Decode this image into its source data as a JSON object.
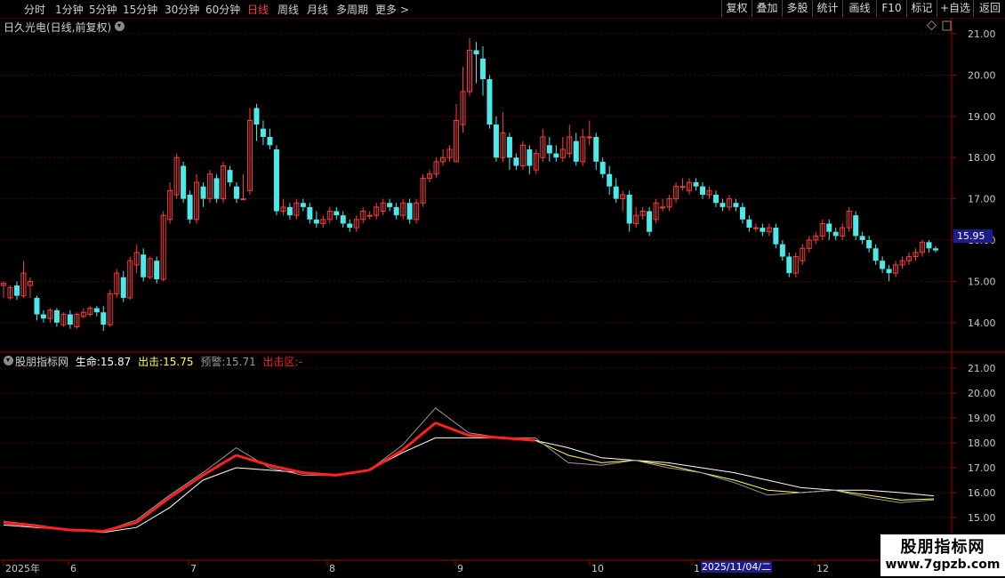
{
  "toolbar": {
    "periods": [
      "分时",
      "1分钟",
      "5分钟",
      "15分钟",
      "30分钟",
      "60分钟",
      "日线",
      "周线",
      "月线",
      "多周期",
      "更多 >"
    ],
    "active_period": "日线",
    "right_buttons": [
      "复权",
      "叠加",
      "多股",
      "统计",
      "画线",
      "F10",
      "标记",
      "+自选",
      "返回"
    ]
  },
  "chart_title": "日久光电(日线,前复权)",
  "current_price": "15.95",
  "indicator": {
    "name": "股朋指标网",
    "life_label": "生命:",
    "life_value": "15.87",
    "exit_label": "出击:",
    "exit_value": "15.75",
    "warn_label": "预警:",
    "warn_value": "15.71",
    "zone_label": "出击区:",
    "zone_value": "-"
  },
  "x_axis": {
    "labels": [
      "2025年",
      "6",
      "7",
      "8",
      "9",
      "10",
      "1",
      "12"
    ],
    "cursor_date": "2025/11/04/二"
  },
  "watermark": {
    "line1": "股朋指标网",
    "line2": "www.7gpzb.com"
  },
  "colors": {
    "up": "#ff3b3b",
    "down": "#4de8e8",
    "grid": "#5a0000",
    "axis": "#a00000",
    "life": "#ffffff",
    "exit": "#ffff55",
    "red_fill": "#ff2020"
  },
  "chart_data": [
    {
      "type": "candlestick",
      "title": "日久光电(日线,前复权)",
      "y_ticks": [
        21.0,
        20.0,
        19.0,
        18.0,
        17.0,
        16.0,
        15.0,
        14.0
      ],
      "ylim": [
        13.5,
        21.4
      ],
      "candles": [
        [
          14.9,
          14.95,
          14.6,
          15.0
        ],
        [
          14.6,
          14.85,
          14.55,
          14.9
        ],
        [
          14.9,
          14.65,
          14.55,
          15.0
        ],
        [
          14.65,
          15.2,
          14.6,
          15.5
        ],
        [
          14.9,
          15.0,
          14.6,
          15.1
        ],
        [
          14.6,
          14.2,
          14.05,
          14.65
        ],
        [
          14.2,
          14.1,
          14.0,
          14.3
        ],
        [
          14.1,
          14.3,
          14.0,
          14.35
        ],
        [
          14.3,
          14.0,
          13.9,
          14.35
        ],
        [
          13.95,
          14.2,
          13.9,
          14.25
        ],
        [
          14.2,
          13.95,
          13.85,
          14.3
        ],
        [
          13.9,
          14.2,
          13.85,
          14.25
        ],
        [
          14.15,
          14.25,
          14.1,
          14.35
        ],
        [
          14.2,
          14.35,
          14.15,
          14.4
        ],
        [
          14.35,
          14.25,
          14.15,
          14.4
        ],
        [
          14.25,
          13.95,
          13.8,
          14.4
        ],
        [
          13.95,
          14.7,
          13.9,
          14.8
        ],
        [
          14.7,
          15.2,
          14.6,
          15.3
        ],
        [
          15.1,
          14.6,
          14.5,
          15.25
        ],
        [
          14.6,
          15.5,
          14.55,
          15.6
        ],
        [
          15.4,
          15.7,
          15.2,
          15.9
        ],
        [
          15.65,
          15.1,
          15.0,
          15.8
        ],
        [
          15.1,
          15.55,
          15.05,
          15.6
        ],
        [
          15.5,
          15.05,
          14.95,
          15.6
        ],
        [
          15.05,
          16.6,
          15.0,
          16.7
        ],
        [
          16.5,
          17.2,
          16.4,
          17.4
        ],
        [
          17.1,
          18.0,
          17.0,
          18.1
        ],
        [
          17.8,
          17.0,
          16.9,
          17.9
        ],
        [
          17.1,
          16.5,
          16.4,
          17.2
        ],
        [
          16.5,
          17.4,
          16.4,
          17.6
        ],
        [
          17.3,
          17.0,
          16.8,
          17.4
        ],
        [
          17.0,
          17.6,
          16.9,
          17.7
        ],
        [
          17.5,
          17.0,
          16.9,
          17.6
        ],
        [
          17.0,
          17.8,
          16.9,
          17.9
        ],
        [
          17.7,
          17.4,
          17.3,
          17.8
        ],
        [
          17.3,
          17.0,
          16.9,
          17.4
        ],
        [
          17.0,
          17.0,
          17.0,
          17.6
        ],
        [
          17.2,
          18.9,
          17.1,
          19.2
        ],
        [
          19.2,
          18.8,
          18.4,
          19.3
        ],
        [
          18.7,
          18.5,
          18.3,
          18.9
        ],
        [
          18.5,
          18.3,
          18.2,
          18.7
        ],
        [
          18.2,
          16.7,
          16.6,
          18.3
        ],
        [
          16.7,
          16.8,
          16.6,
          17.0
        ],
        [
          16.8,
          16.6,
          16.5,
          16.9
        ],
        [
          16.6,
          16.9,
          16.5,
          17.0
        ],
        [
          16.9,
          16.8,
          16.7,
          17.0
        ],
        [
          16.8,
          16.5,
          16.4,
          16.9
        ],
        [
          16.5,
          16.4,
          16.3,
          16.7
        ],
        [
          16.4,
          16.5,
          16.3,
          16.6
        ],
        [
          16.5,
          16.7,
          16.4,
          16.8
        ],
        [
          16.7,
          16.6,
          16.5,
          16.8
        ],
        [
          16.6,
          16.4,
          16.3,
          16.7
        ],
        [
          16.4,
          16.3,
          16.2,
          16.5
        ],
        [
          16.3,
          16.5,
          16.2,
          16.6
        ],
        [
          16.5,
          16.7,
          16.4,
          16.8
        ],
        [
          16.6,
          16.6,
          16.5,
          16.7
        ],
        [
          16.6,
          16.8,
          16.5,
          16.9
        ],
        [
          16.7,
          16.9,
          16.6,
          17.0
        ],
        [
          16.9,
          16.8,
          16.7,
          17.0
        ],
        [
          16.8,
          16.6,
          16.5,
          16.9
        ],
        [
          16.6,
          16.9,
          16.5,
          17.0
        ],
        [
          16.9,
          16.5,
          16.4,
          17.0
        ],
        [
          16.5,
          16.9,
          16.4,
          17.0
        ],
        [
          16.9,
          17.5,
          16.8,
          17.6
        ],
        [
          17.5,
          17.6,
          17.4,
          17.7
        ],
        [
          17.6,
          17.9,
          17.5,
          18.0
        ],
        [
          17.9,
          18.0,
          17.8,
          18.2
        ],
        [
          18.0,
          18.2,
          17.9,
          18.3
        ],
        [
          17.9,
          18.9,
          17.9,
          19.3
        ],
        [
          18.8,
          19.6,
          18.6,
          20.2
        ],
        [
          19.6,
          20.6,
          19.5,
          20.9
        ],
        [
          20.6,
          20.5,
          19.8,
          20.8
        ],
        [
          20.4,
          19.9,
          19.5,
          20.7
        ],
        [
          19.9,
          18.8,
          18.7,
          20.0
        ],
        [
          18.8,
          18.0,
          17.9,
          19.0
        ],
        [
          18.0,
          18.6,
          17.9,
          19.1
        ],
        [
          18.5,
          18.0,
          17.7,
          18.6
        ],
        [
          18.0,
          17.8,
          17.7,
          18.1
        ],
        [
          17.8,
          18.3,
          17.7,
          18.4
        ],
        [
          18.2,
          17.8,
          17.6,
          18.3
        ],
        [
          17.7,
          18.1,
          17.6,
          18.2
        ],
        [
          18.0,
          18.5,
          17.9,
          18.7
        ],
        [
          18.3,
          18.1,
          17.9,
          18.5
        ],
        [
          18.1,
          18.0,
          17.9,
          18.3
        ],
        [
          18.0,
          18.2,
          17.9,
          18.5
        ],
        [
          18.1,
          18.5,
          18.0,
          18.8
        ],
        [
          18.4,
          17.9,
          17.8,
          18.6
        ],
        [
          17.9,
          18.5,
          17.8,
          18.7
        ],
        [
          18.5,
          18.5,
          18.3,
          18.9
        ],
        [
          18.5,
          17.9,
          17.7,
          18.6
        ],
        [
          17.9,
          17.6,
          17.5,
          18.0
        ],
        [
          17.6,
          17.3,
          17.1,
          17.8
        ],
        [
          17.3,
          17.0,
          16.9,
          17.5
        ],
        [
          17.0,
          17.1,
          16.7,
          17.2
        ],
        [
          17.1,
          16.4,
          16.2,
          17.2
        ],
        [
          16.4,
          16.6,
          16.3,
          16.8
        ],
        [
          16.6,
          16.7,
          16.5,
          16.8
        ],
        [
          16.7,
          16.2,
          16.1,
          16.8
        ],
        [
          16.5,
          16.9,
          16.4,
          17.0
        ],
        [
          16.8,
          16.8,
          16.7,
          17.0
        ],
        [
          16.8,
          17.0,
          16.7,
          17.1
        ],
        [
          17.0,
          17.3,
          16.9,
          17.4
        ],
        [
          17.3,
          17.3,
          17.2,
          17.5
        ],
        [
          17.2,
          17.4,
          17.1,
          17.5
        ],
        [
          17.4,
          17.3,
          17.2,
          17.5
        ],
        [
          17.3,
          17.1,
          17.0,
          17.4
        ],
        [
          17.1,
          17.2,
          17.0,
          17.3
        ],
        [
          17.1,
          16.9,
          16.8,
          17.2
        ],
        [
          16.9,
          16.8,
          16.7,
          17.0
        ],
        [
          16.8,
          17.0,
          16.7,
          17.1
        ],
        [
          16.9,
          16.8,
          16.7,
          17.0
        ],
        [
          16.8,
          16.5,
          16.4,
          16.9
        ],
        [
          16.5,
          16.3,
          16.2,
          16.6
        ],
        [
          16.3,
          16.3,
          16.2,
          16.4
        ],
        [
          16.3,
          16.2,
          16.1,
          16.4
        ],
        [
          16.2,
          16.3,
          16.1,
          16.4
        ],
        [
          16.3,
          15.9,
          15.8,
          16.4
        ],
        [
          15.9,
          15.6,
          15.5,
          16.0
        ],
        [
          15.6,
          15.2,
          15.1,
          15.7
        ],
        [
          15.2,
          15.6,
          15.1,
          15.7
        ],
        [
          15.5,
          15.8,
          15.4,
          15.9
        ],
        [
          15.8,
          16.0,
          15.7,
          16.1
        ],
        [
          16.0,
          16.1,
          15.9,
          16.2
        ],
        [
          16.1,
          16.4,
          16.0,
          16.5
        ],
        [
          16.4,
          16.2,
          16.0,
          16.5
        ],
        [
          16.2,
          16.1,
          16.0,
          16.3
        ],
        [
          16.1,
          16.3,
          16.0,
          16.4
        ],
        [
          16.3,
          16.7,
          16.2,
          16.8
        ],
        [
          16.6,
          16.1,
          16.0,
          16.7
        ],
        [
          16.1,
          16.0,
          15.9,
          16.2
        ],
        [
          16.0,
          15.8,
          15.7,
          16.1
        ],
        [
          15.8,
          15.5,
          15.4,
          15.9
        ],
        [
          15.5,
          15.3,
          15.2,
          15.6
        ],
        [
          15.3,
          15.2,
          15.0,
          15.4
        ],
        [
          15.2,
          15.4,
          15.1,
          15.5
        ],
        [
          15.4,
          15.5,
          15.3,
          15.6
        ],
        [
          15.5,
          15.6,
          15.4,
          15.7
        ],
        [
          15.6,
          15.7,
          15.5,
          15.8
        ],
        [
          15.7,
          15.95,
          15.6,
          16.0
        ],
        [
          15.95,
          15.8,
          15.7,
          16.0
        ],
        [
          15.8,
          15.75,
          15.7,
          15.85
        ]
      ]
    },
    {
      "type": "line",
      "title": "股朋指标网",
      "y_ticks": [
        21.0,
        20.0,
        19.0,
        18.0,
        17.0,
        16.0,
        15.0
      ],
      "ylim": [
        14.6,
        21.3
      ],
      "series": [
        {
          "name": "生命",
          "values": [
            14.7,
            14.6,
            14.5,
            14.4,
            14.6,
            15.4,
            16.5,
            17.0,
            16.9,
            16.8,
            16.7,
            16.9,
            17.6,
            18.2,
            18.2,
            18.2,
            18.1,
            17.8,
            17.4,
            17.3,
            17.2,
            17.0,
            16.8,
            16.5,
            16.2,
            16.1,
            16.1,
            16.0,
            15.87
          ]
        },
        {
          "name": "出击",
          "values": [
            14.8,
            14.65,
            14.5,
            14.45,
            14.8,
            15.8,
            16.7,
            17.5,
            17.1,
            16.8,
            16.7,
            16.9,
            17.7,
            18.8,
            18.3,
            18.2,
            18.1,
            17.5,
            17.2,
            17.3,
            17.1,
            16.8,
            16.5,
            16.1,
            16.0,
            16.1,
            15.9,
            15.7,
            15.75
          ]
        },
        {
          "name": "预警",
          "values": [
            14.85,
            14.7,
            14.5,
            14.45,
            14.9,
            15.9,
            16.8,
            17.8,
            17.0,
            16.7,
            16.7,
            16.9,
            17.9,
            19.4,
            18.4,
            18.2,
            18.2,
            17.2,
            17.1,
            17.3,
            17.0,
            16.8,
            16.4,
            15.9,
            16.0,
            16.1,
            15.8,
            15.6,
            15.71
          ]
        }
      ]
    }
  ]
}
